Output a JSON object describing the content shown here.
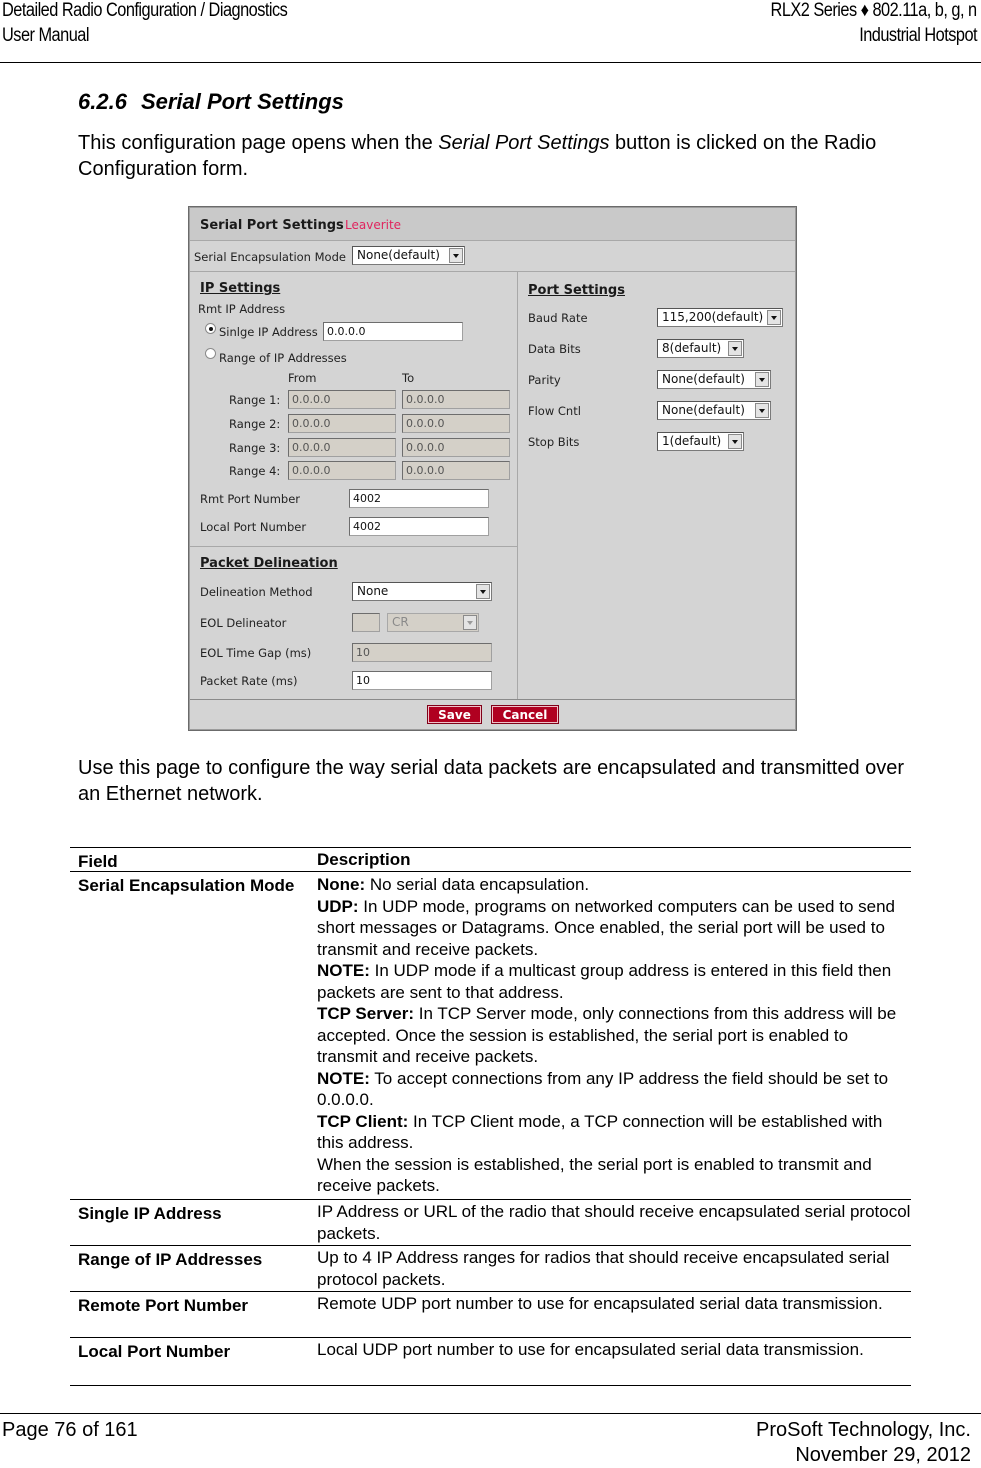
{
  "header": {
    "left_line1": "Detailed Radio Configuration / Diagnostics",
    "left_line2": "User Manual",
    "right_line1": "RLX2 Series ♦ 802.11a, b, g, n",
    "right_line2": "Industrial Hotspot"
  },
  "section": {
    "number": "6.2.6",
    "title": "Serial Port Settings"
  },
  "intro": {
    "before": "This configuration page opens when the ",
    "emphasis": "Serial Port Settings",
    "after": " button is clicked on the Radio Configuration form."
  },
  "form": {
    "title": "Serial Port Settings",
    "subtitle": "Leaverite",
    "encapsulation_label": "Serial Encapsulation Mode",
    "encapsulation_value": "None(default)",
    "ip_settings": {
      "heading": "IP Settings",
      "rmt_ip_label": "Rmt IP Address",
      "single_label": "Sinlge IP Address",
      "single_value": "0.0.0.0",
      "single_selected": true,
      "range_label": "Range of IP Addresses",
      "range_selected": false,
      "from_label": "From",
      "to_label": "To",
      "ranges": [
        {
          "label": "Range 1:",
          "from": "0.0.0.0",
          "to": "0.0.0.0"
        },
        {
          "label": "Range 2:",
          "from": "0.0.0.0",
          "to": "0.0.0.0"
        },
        {
          "label": "Range 3:",
          "from": "0.0.0.0",
          "to": "0.0.0.0"
        },
        {
          "label": "Range 4:",
          "from": "0.0.0.0",
          "to": "0.0.0.0"
        }
      ],
      "rmt_port_label": "Rmt Port Number",
      "rmt_port_value": "4002",
      "local_port_label": "Local Port Number",
      "local_port_value": "4002"
    },
    "port_settings": {
      "heading": "Port Settings",
      "fields": [
        {
          "label": "Baud Rate",
          "value": "115,200(default)"
        },
        {
          "label": "Data Bits",
          "value": "8(default)"
        },
        {
          "label": "Parity",
          "value": "None(default)"
        },
        {
          "label": "Flow Cntl",
          "value": "None(default)"
        },
        {
          "label": "Stop Bits",
          "value": "1(default)"
        }
      ]
    },
    "packet_delineation": {
      "heading": "Packet Delineation",
      "method_label": "Delineation Method",
      "method_value": "None",
      "eol_label": "EOL Delineator",
      "eol_char_value": "",
      "eol_select_value": "CR",
      "gap_label": "EOL Time Gap (ms)",
      "gap_value": "10",
      "rate_label": "Packet Rate (ms)",
      "rate_value": "10"
    },
    "save_label": "Save",
    "cancel_label": "Cancel",
    "colors": {
      "subtitle": "#e0245e",
      "button": "#b00020",
      "panel": "#d4d4d4"
    }
  },
  "usage_text": "Use this page to configure the way serial data packets are encapsulated and transmitted over an Ethernet network.",
  "table": {
    "header_field": "Field",
    "header_description": "Description",
    "rows": [
      {
        "field": "Serial Encapsulation Mode",
        "description": [
          {
            "bold": "None:",
            "text": " No serial data encapsulation."
          },
          {
            "bold": "UDP:",
            "text": " In UDP mode, programs on networked computers can be used to send short messages or Datagrams. Once enabled, the serial port will be used to transmit and receive packets."
          },
          {
            "bold": "NOTE:",
            "text": " In UDP mode if a multicast group address is entered in this field then packets are sent to that address."
          },
          {
            "bold": "TCP Server:",
            "text": " In TCP Server mode, only connections from this address will be accepted. Once the session is established, the serial port is enabled to transmit and receive packets."
          },
          {
            "bold": "NOTE:",
            "text": " To accept connections from any IP address the field should be set to 0.0.0.0."
          },
          {
            "bold": "TCP Client:",
            "text": " In TCP Client mode, a TCP connection will be established with this address."
          },
          {
            "bold": "",
            "text": "When the session is established, the serial port is enabled to transmit and receive packets."
          }
        ]
      },
      {
        "field": "Single IP Address",
        "description": [
          {
            "bold": "",
            "text": "IP Address or URL of the radio that should receive encapsulated serial protocol packets."
          }
        ]
      },
      {
        "field": "Range of IP Addresses",
        "description": [
          {
            "bold": "",
            "text": "Up to 4 IP Address ranges for radios that should receive encapsulated serial protocol packets."
          }
        ]
      },
      {
        "field": "Remote Port Number",
        "description": [
          {
            "bold": "",
            "text": "Remote UDP port number to use for encapsulated serial data transmission."
          }
        ]
      },
      {
        "field": "Local Port Number",
        "description": [
          {
            "bold": "",
            "text": "Local UDP port number to use for encapsulated serial data transmission."
          }
        ]
      }
    ]
  },
  "footer": {
    "page": "Page 76 of 161",
    "company": "ProSoft Technology, Inc.",
    "date": "November 29, 2012"
  }
}
